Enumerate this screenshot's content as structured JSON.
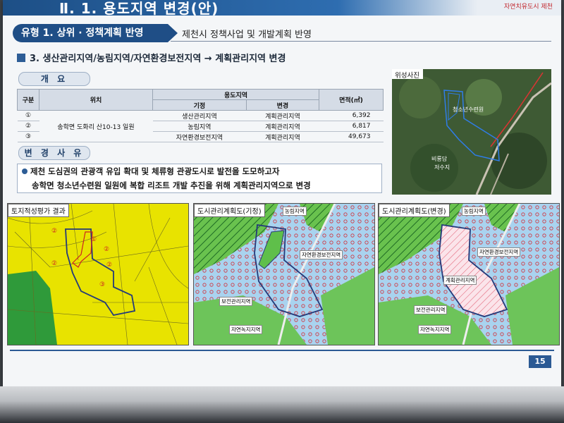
{
  "header": {
    "title": "Ⅱ. 1. 용도지역 변경(안)",
    "logo_text": "자연치유도시 제천"
  },
  "type_bar": {
    "label": "유형 1. 상위 · 정책계획 반영",
    "subtitle": "제천시 정책사업 및 개발계획 반영"
  },
  "section": {
    "title": "3. 생산관리지역/농림지역/자연환경보전지역 → 계획관리지역 변경"
  },
  "overview": {
    "label": "개 요",
    "headers": {
      "no": "구분",
      "location": "위치",
      "zoning": "용도지역",
      "existing": "기정",
      "change": "변경",
      "area": "면적(㎡)"
    },
    "location": "송학면 도화리 산10-13 일원",
    "rows": [
      {
        "no": "①",
        "existing": "생산관리지역",
        "change": "계획관리지역",
        "area": "6,392"
      },
      {
        "no": "②",
        "existing": "농림지역",
        "change": "계획관리지역",
        "area": "6,817"
      },
      {
        "no": "③",
        "existing": "자연환경보전지역",
        "change": "계획관리지역",
        "area": "49,673"
      }
    ]
  },
  "reason": {
    "label": "변 경 사 유",
    "line1": "제천 도심권의 관광객 유입 확대 및 체류형 관광도시로 발전을 도모하고자",
    "line2": "송학면 청소년수련원 일원에 복합 리조트 개발 추진을 위해 계획관리지역으로 변경"
  },
  "satellite": {
    "title": "위성사진",
    "label_center": "청소년수련원",
    "label_reservoir1": "비룡담",
    "label_reservoir2": "저수지"
  },
  "map1": {
    "title": "토지적성평가 결과",
    "marks": [
      "②",
      "①",
      "②",
      "②",
      "②",
      "③"
    ]
  },
  "map2": {
    "title": "도시관리계획도(기정)",
    "labels": {
      "farm": "농림지역",
      "nature": "자연환경보전지역",
      "conserve": "보전관리지역",
      "greenNat": "자연녹지지역"
    }
  },
  "map3": {
    "title": "도시관리계획도(변경)",
    "labels": {
      "farm": "농림지역",
      "nature": "자연환경보전지역",
      "plan": "계획관리지역",
      "conserve": "보전관리지역",
      "greenNat": "자연녹지지역"
    }
  },
  "page": {
    "number": "15"
  }
}
